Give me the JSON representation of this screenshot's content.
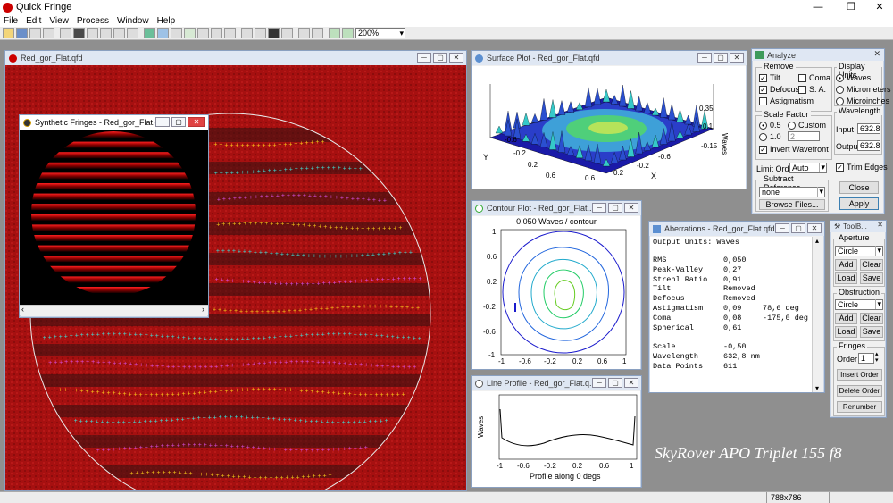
{
  "app": {
    "title": "Quick Fringe",
    "window_controls": [
      "—",
      "❐",
      "✕"
    ]
  },
  "menu": [
    "File",
    "Edit",
    "View",
    "Process",
    "Window",
    "Help"
  ],
  "toolbar": {
    "zoom": "200%"
  },
  "status": {
    "image_size": "788x786"
  },
  "main_window": {
    "title": "Red_gor_Flat.qfd"
  },
  "synthetic": {
    "title": "Synthetic Fringes - Red_gor_Flat.qfd"
  },
  "surface": {
    "title": "Surface Plot - Red_gor_Flat.qfd",
    "ticks_y": [
      "-0.6",
      "-0.2",
      "0.2",
      "0.6"
    ],
    "ticks_x": [
      "0.6",
      "0.2",
      "-0.2",
      "-0.6"
    ],
    "ticks_z": [
      "0.35",
      "0.1",
      "-0.15"
    ],
    "label_x": "X",
    "label_y": "Y",
    "label_z": "Waves"
  },
  "contour": {
    "title": "Contour Plot - Red_gor_Flat...",
    "heading": "0,050 Waves / contour",
    "ticks_y": [
      "1",
      "0.6",
      "0.2",
      "-0.2",
      "-0.6",
      "-1"
    ],
    "ticks_x": [
      "-1",
      "-0.6",
      "-0.2",
      "0.2",
      "0.6",
      "1"
    ]
  },
  "profile": {
    "title": "Line Profile - Red_gor_Flat.q...",
    "ylabel": "Waves",
    "xlabel": "Profile along 0 degs",
    "ticks_x": [
      "-1",
      "-0.6",
      "-0.2",
      "0.2",
      "0.6",
      "1"
    ]
  },
  "aberrations": {
    "title": "Aberrations - Red_gor_Flat.qfd",
    "header": "Output Units: Waves",
    "rows": [
      [
        "RMS",
        "0,050",
        ""
      ],
      [
        "Peak-Valley",
        "0,27",
        ""
      ],
      [
        "Strehl Ratio",
        "0,91",
        ""
      ],
      [
        "Tilt",
        "Removed",
        ""
      ],
      [
        "Defocus",
        "Removed",
        ""
      ],
      [
        "Astigmatism",
        "0,09",
        "78,6 deg"
      ],
      [
        "Coma",
        "0,08",
        "-175,0 deg"
      ],
      [
        "Spherical",
        "0,61",
        ""
      ]
    ],
    "rows2": [
      [
        "Scale",
        "-0,50"
      ],
      [
        "Wavelength",
        "632,8 nm"
      ],
      [
        "Data Points",
        "611"
      ]
    ]
  },
  "analyze": {
    "title": "Analyze",
    "remove_label": "Remove",
    "tilt": "Tilt",
    "coma": "Coma",
    "defocus": "Defocus",
    "sa": "S. A.",
    "astig": "Astigmatism",
    "units_label": "Display Units",
    "waves": "Waves",
    "micrometers": "Micrometers",
    "microinches": "Microinches",
    "scale_label": "Scale Factor",
    "s05": "0.5",
    "custom": "Custom",
    "s10": "1.0",
    "custom_value": "2",
    "invert": "Invert Wavefront",
    "wl_label": "Wavelength",
    "input_label": "Input",
    "input_value": "632.8",
    "output_label": "Output",
    "output_value": "632.8",
    "limit_label": "Limit Order",
    "limit_value": "Auto",
    "trim": "Trim Edges",
    "subtract_label": "Subtract Reference",
    "subtract_value": "none",
    "browse": "Browse Files...",
    "close": "Close",
    "apply": "Apply"
  },
  "toolbox": {
    "title": "ToolB...",
    "aperture": "Aperture",
    "aperture_shape": "Circle",
    "add": "Add",
    "clear": "Clear",
    "load": "Load",
    "save": "Save",
    "obstruction": "Obstruction",
    "obstruction_shape": "Circle",
    "fringes": "Fringes",
    "order_label": "Order",
    "order_value": "1",
    "insert": "Insert Order",
    "delete": "Delete Order",
    "renumber": "Renumber"
  },
  "watermark": "SkyRover APO Triplet 155 f8"
}
